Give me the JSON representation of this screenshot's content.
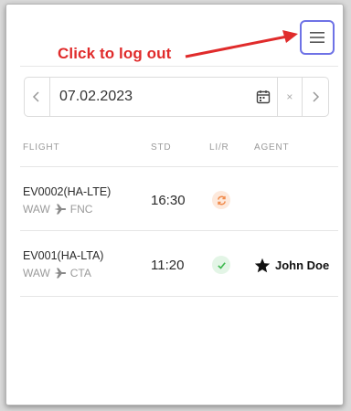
{
  "annotation": {
    "text": "Click to log out",
    "color": "#e02b2b"
  },
  "menu_button": {
    "icon": "hamburger-menu-icon",
    "border_color": "#6e72e6"
  },
  "date_picker": {
    "value": "07.02.2023",
    "prev_icon": "chevron-left-icon",
    "next_icon": "chevron-right-icon",
    "calendar_icon": "calendar-icon",
    "clear_label": "×"
  },
  "table": {
    "columns": [
      "FLIGHT",
      "STD",
      "LI/R",
      "AGENT"
    ],
    "rows": [
      {
        "flight": "EV0002(HA-LTE)",
        "origin": "WAW",
        "destination": "FNC",
        "std": "16:30",
        "status": "pending",
        "status_icon": "refresh-icon",
        "agent": ""
      },
      {
        "flight": "EV001(HA-LTA)",
        "origin": "WAW",
        "destination": "CTA",
        "std": "11:20",
        "status": "done",
        "status_icon": "check-icon",
        "agent": "John Doe",
        "agent_icon": "star-icon"
      }
    ]
  },
  "colors": {
    "status_pending": "#f08a4b",
    "status_done": "#3fb950",
    "accent": "#6e72e6"
  }
}
